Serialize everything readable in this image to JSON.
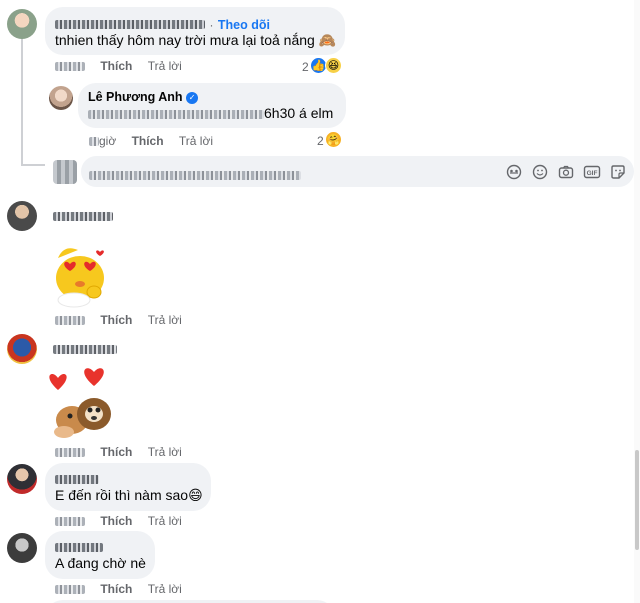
{
  "comments": {
    "c1": {
      "follow_label": "Theo dõi",
      "text": "tnhien thấy hôm nay trời mưa lại toả nắng 🙈",
      "like_label": "Thích",
      "reply_label": "Trả lời",
      "reaction_count": "2"
    },
    "c1_reply": {
      "author": "Lê Phương Anh",
      "text_visible": "6h30 á elm",
      "time_tail": "giờ",
      "like_label": "Thích",
      "reply_label": "Trả lời",
      "reaction_count": "2"
    },
    "c2": {
      "like_label": "Thích",
      "reply_label": "Trả lời"
    },
    "c3": {
      "like_label": "Thích",
      "reply_label": "Trả lời"
    },
    "c4": {
      "text": "E đến rồi thì nàm sao😄",
      "like_label": "Thích",
      "reply_label": "Trả lời"
    },
    "c5": {
      "text": "A đang chờ nè",
      "like_label": "Thích",
      "reply_label": "Trả lời"
    }
  },
  "composer_icons": [
    "sticker-face-icon",
    "emoji-icon",
    "camera-icon",
    "gif-icon",
    "sticker-icon"
  ],
  "colors": {
    "bubble": "#f0f2f5",
    "meta": "#65676b",
    "accent": "#1877f2",
    "like": "#1877f2"
  }
}
